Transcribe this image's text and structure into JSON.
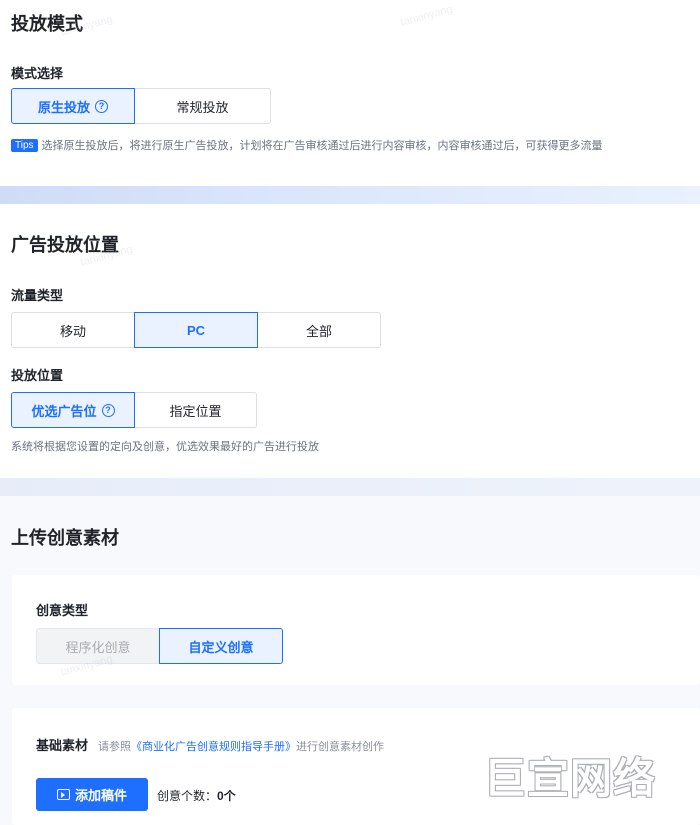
{
  "delivery_mode": {
    "title": "投放模式",
    "mode_label": "模式选择",
    "options": [
      {
        "label": "原生投放",
        "help": "?"
      },
      {
        "label": "常规投放"
      }
    ],
    "tips_badge": "Tips",
    "tips_text": "选择原生投放后，将进行原生广告投放，计划将在广告审核通过后进行内容审核，内容审核通过后，可获得更多流量"
  },
  "placement": {
    "title": "广告投放位置",
    "traffic_label": "流量类型",
    "traffic_options": [
      "移动",
      "PC",
      "全部"
    ],
    "position_label": "投放位置",
    "position_options": [
      {
        "label": "优选广告位",
        "help": "?"
      },
      {
        "label": "指定位置"
      }
    ],
    "hint": "系统将根据您设置的定向及创意，优选效果最好的广告进行投放"
  },
  "creative": {
    "title": "上传创意素材",
    "type_label": "创意类型",
    "type_options": [
      "程序化创意",
      "自定义创意"
    ],
    "basic_label": "基础素材",
    "ref_prefix": "请参照",
    "ref_link": "《商业化广告创意规则指导手册》",
    "ref_suffix": "进行创意素材创作",
    "add_button": "添加稿件",
    "count_label": "创意个数：",
    "count_value": "0个"
  },
  "watermark": {
    "logo_text": "巨宣网络",
    "text": "tanxinyang"
  },
  "colors": {
    "accent": "#1e6fff",
    "active_bg": "#eaf2ff",
    "page_bg": "#eef3fb"
  }
}
